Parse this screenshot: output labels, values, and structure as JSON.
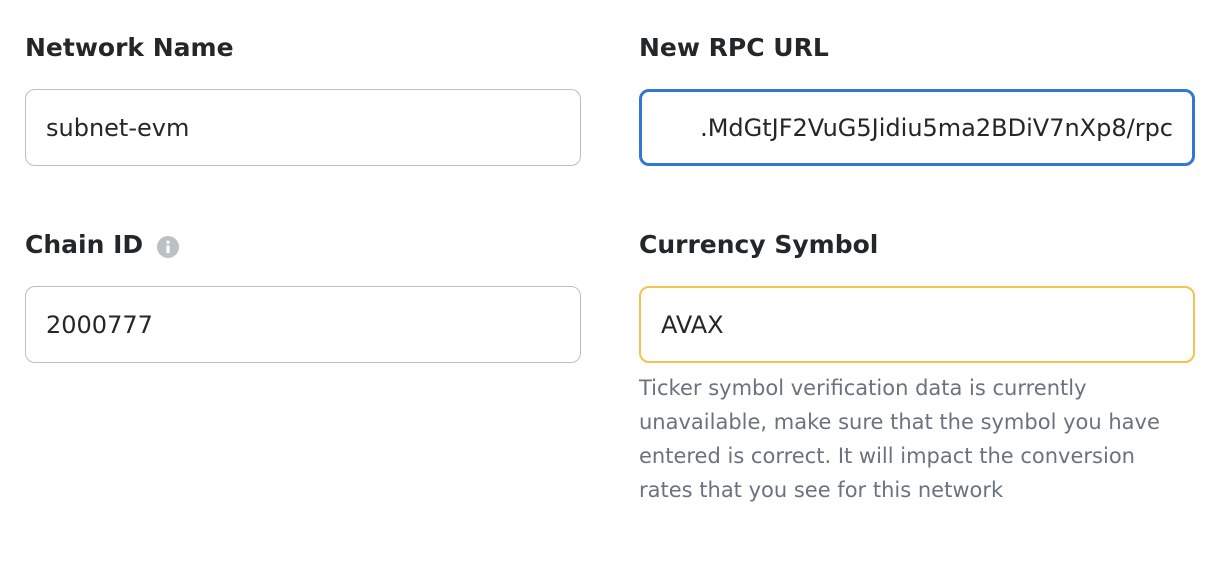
{
  "form": {
    "network_name": {
      "label": "Network Name",
      "value": "subnet-evm"
    },
    "rpc_url": {
      "label": "New RPC URL",
      "value": ".MdGtJF2VuG5Jidiu5ma2BDiV7nXp8/rpc"
    },
    "chain_id": {
      "label": "Chain ID",
      "value": "2000777",
      "info_icon": "info-circle-icon"
    },
    "currency_symbol": {
      "label": "Currency Symbol",
      "value": "AVAX",
      "warning": "Ticker symbol verification data is currently unavailable, make sure that the symbol you have entered is correct. It will impact the conversion rates that you see for this network"
    }
  },
  "colors": {
    "focus_border": "#3277d0",
    "warning_border": "#f0c44d",
    "default_border": "#bbc0c5",
    "helper_text": "#6a737d"
  }
}
